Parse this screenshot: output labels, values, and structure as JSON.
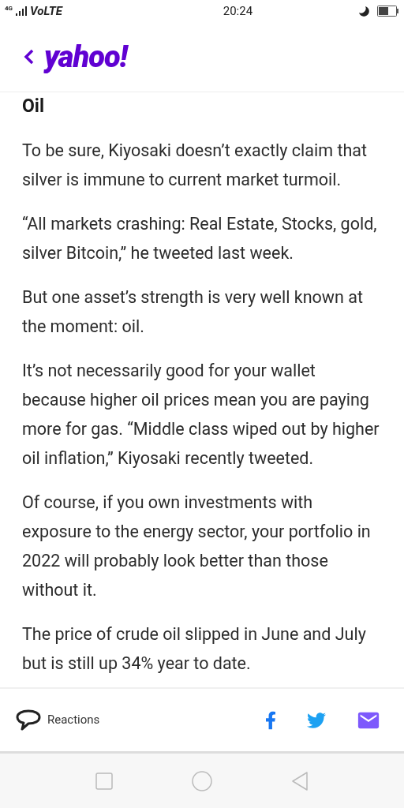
{
  "status_bar": {
    "network": "4G",
    "carrier": "VoLTE",
    "time": "20:24"
  },
  "header": {
    "logo": "yahoo!"
  },
  "article": {
    "heading": "Oil",
    "paragraphs": [
      "To be sure, Kiyosaki doesn’t exactly claim that silver is immune to current market turmoil.",
      "“All markets crashing: Real Estate, Stocks, gold, silver Bitcoin,” he tweeted last week.",
      "But one asset’s strength is very well known at the moment: oil.",
      "It’s not necessarily good for your wallet because higher oil prices mean you are paying more for gas. “Middle class wiped out by higher oil inflation,” Kiyosaki recently tweeted.",
      "Of course, if you own investments with exposure to the energy sector, your portfolio in 2022 will probably look better than those without it.",
      "The price of crude oil slipped in June and July but is still up 34% year to date."
    ]
  },
  "action_bar": {
    "reactions": "Reactions"
  }
}
